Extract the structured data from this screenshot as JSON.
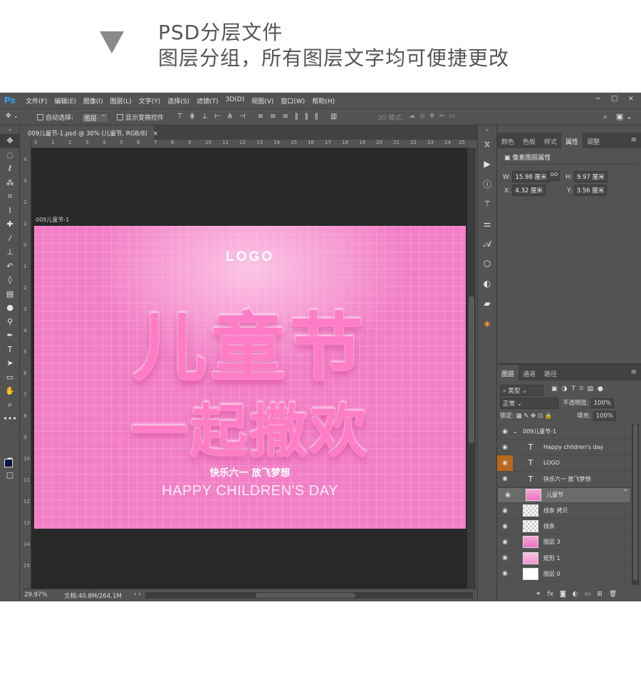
{
  "header": {
    "line1": "PSD分层文件",
    "line2": "图层分组，所有图层文字均可便捷更改"
  },
  "app": {
    "logo": "Ps",
    "menus": [
      "文件(F)",
      "编辑(E)",
      "图像(I)",
      "图层(L)",
      "文字(Y)",
      "选择(S)",
      "滤镜(T)",
      "3D(D)",
      "视图(V)",
      "窗口(W)",
      "帮助(H)"
    ],
    "window_buttons": [
      "−",
      "□",
      "×"
    ]
  },
  "options": {
    "auto_select_label": "自动选择:",
    "auto_select_value": "图层",
    "show_transform_label": "显示变换控件",
    "mode_3d_label": "3D 模式:"
  },
  "document": {
    "tab_title": "009儿童节-1.psd @ 30% (儿童节, RGB/8)",
    "tab_close": "×",
    "artboard_label": "009儿童节-1",
    "ruler_h": [
      "0",
      "1",
      "2",
      "3",
      "4",
      "5",
      "6",
      "7",
      "8",
      "9",
      "10",
      "11",
      "12",
      "13",
      "14",
      "15",
      "16",
      "17",
      "18",
      "19",
      "20",
      "21",
      "22",
      "23",
      "24",
      "25"
    ],
    "ruler_v": [
      "4",
      "3",
      "2",
      "1",
      "0",
      "1",
      "2",
      "3",
      "4",
      "5",
      "6",
      "7",
      "8",
      "9",
      "10",
      "11",
      "12",
      "13",
      "14",
      "15"
    ],
    "canvas": {
      "logo": "LOGO",
      "title_line1": "儿童节",
      "title_line2": "一起撒欢",
      "subtitle_cn": "快乐六一 放飞梦想",
      "subtitle_en": "HAPPY CHILDREN'S DAY"
    }
  },
  "status": {
    "zoom": "29.97%",
    "doc_size": "文档:40.8M/264.1M",
    "arrows": "›  ‹"
  },
  "panels_top": {
    "tabs": [
      "颜色",
      "色板",
      "样式",
      "属性",
      "调整"
    ],
    "active_tab": "属性",
    "title": "像素图层属性",
    "w_label": "W:",
    "w_value": "15.98 厘米",
    "h_label": "H:",
    "h_value": "9.97 厘米",
    "x_label": "X:",
    "x_value": "4.32 厘米",
    "y_label": "Y:",
    "y_value": "3.56 厘米",
    "link_icon": "GO"
  },
  "layers_panel": {
    "tabs": [
      "图层",
      "通道",
      "路径"
    ],
    "active_tab": "图层",
    "filter_label": "类型",
    "blend_mode": "正常",
    "opacity_label": "不透明度:",
    "opacity_value": "100%",
    "lock_label": "锁定:",
    "fill_label": "填充:",
    "fill_value": "100%",
    "layers": [
      {
        "name": "009儿童节-1",
        "kind": "group"
      },
      {
        "name": "Happy children's day",
        "kind": "text"
      },
      {
        "name": "LOGO",
        "kind": "text"
      },
      {
        "name": "快乐六一 放飞梦想",
        "kind": "text"
      },
      {
        "name": "儿童节",
        "kind": "pink",
        "selected": true
      },
      {
        "name": "线条 拷贝",
        "kind": "checker"
      },
      {
        "name": "线条",
        "kind": "checker"
      },
      {
        "name": "图层 3",
        "kind": "pink"
      },
      {
        "name": "矩形 1",
        "kind": "rect"
      },
      {
        "name": "图层 0",
        "kind": "white"
      }
    ],
    "footer_icons": [
      "link-icon",
      "fx-icon",
      "mask-icon",
      "adjustment-icon",
      "folder-icon",
      "new-layer-icon",
      "trash-icon"
    ]
  },
  "colors": {
    "ps_blue": "#31a8ff",
    "canvas_pink": "#f27fc6",
    "title_pink": "#ff7cc6",
    "vis_highlight": "#b96a1c"
  }
}
